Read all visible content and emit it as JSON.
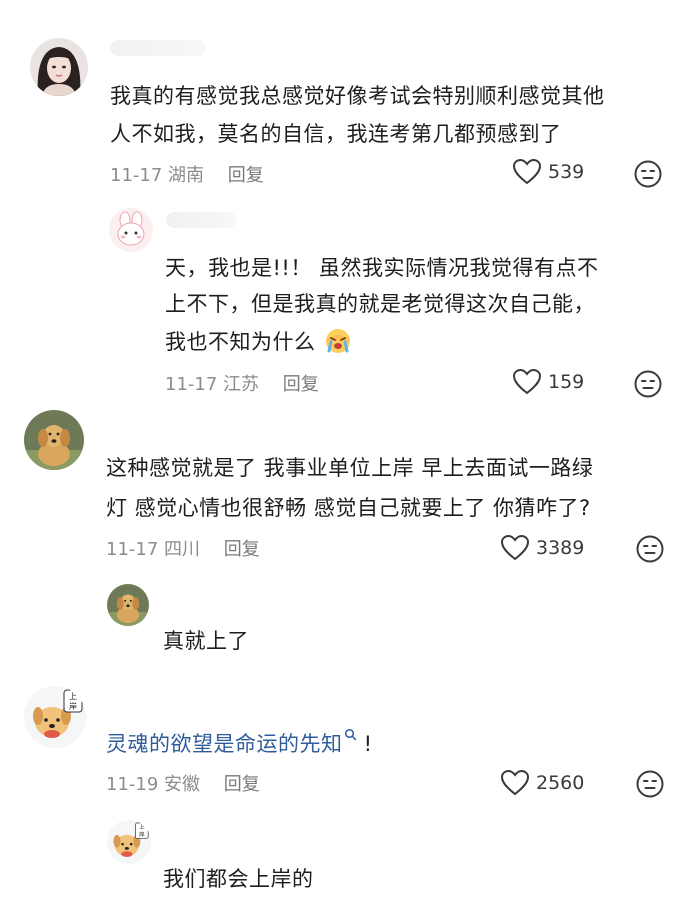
{
  "comments": [
    {
      "text_line1": "我真的有感觉我总感觉好像考试会特别顺利感觉其他",
      "text_line2": "人不如我，莫名的自信，我连考第几都预感到了",
      "date": "11-17",
      "location": "湖南",
      "reply_label": "回复",
      "likes": "539",
      "avatar_icon": "girl-avatar-icon"
    },
    {
      "text_line1": "天，我也是!!！ 虽然我实际情况我觉得有点不",
      "text_line2": "上不下，但是我真的就是老觉得这次自己能，",
      "text_line3": "我也不知为什么",
      "emoji_icon": "crying-face-emoji-icon",
      "date": "11-17",
      "location": "江苏",
      "reply_label": "回复",
      "likes": "159",
      "avatar_icon": "pink-bunny-avatar-icon"
    },
    {
      "text_line1": "这种感觉就是了 我事业单位上岸 早上去面试一路绿",
      "text_line2": "灯 感觉心情也很舒畅 感觉自己就要上了 你猜咋了?",
      "date": "11-17",
      "location": "四川",
      "reply_label": "回复",
      "likes": "3389",
      "avatar_icon": "golden-retriever-avatar-icon"
    },
    {
      "text_line1": "真就上了",
      "avatar_icon": "golden-retriever-avatar-icon"
    },
    {
      "text_link": "灵魂的欲望是命运的先知",
      "text_suffix": " !",
      "search_icon": "search-icon",
      "date": "11-19",
      "location": "安徽",
      "reply_label": "回复",
      "likes": "2560",
      "avatar_icon": "cartoon-dog-shangan-avatar-icon",
      "avatar_badge": "上岸"
    },
    {
      "text_line1": "我们都会上岸的",
      "avatar_icon": "cartoon-dog-shangan-avatar-icon",
      "avatar_badge": "上岸"
    }
  ],
  "icons": {
    "like": "heart-outline-icon",
    "dislike": "unhappy-face-icon"
  },
  "colors": {
    "link": "#2f5d9c",
    "meta": "#8c8c8c",
    "text": "#1e1e1e"
  }
}
